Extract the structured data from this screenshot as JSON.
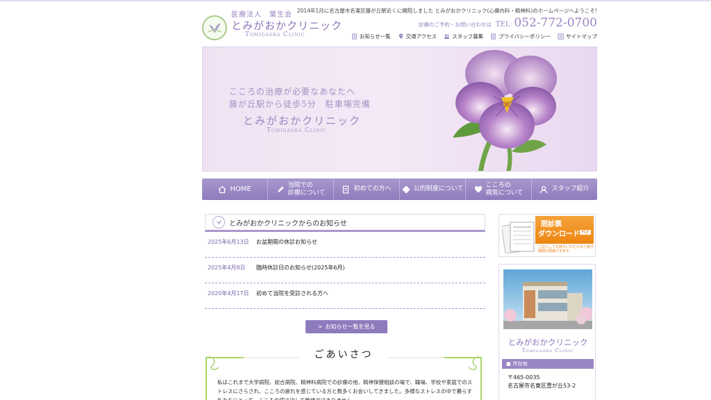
{
  "header": {
    "logo_org": "医療法人　葉生会",
    "logo_name": "とみがおかクリニック",
    "logo_en": "Tomigaoka Clinic",
    "tagline": "2014年1月に名古屋市名東区藤が丘駅近くに開院しました とみがおかクリニック(心療内科・精神科)のホームページへようこそ!",
    "contact_label": "診療のご予約・お問い合わせは",
    "tel_label": "TEL",
    "tel": "052-772-0700",
    "util_nav": [
      {
        "label": "お知らせ一覧",
        "icon": "document-icon"
      },
      {
        "label": "交通アクセス",
        "icon": "map-pin-icon"
      },
      {
        "label": "スタッフ募集",
        "icon": "people-icon"
      },
      {
        "label": "プライバシーポリシー",
        "icon": "document-icon"
      },
      {
        "label": "サイトマップ",
        "icon": "sitemap-icon"
      }
    ]
  },
  "hero": {
    "line1": "こころの治療が必要なあなたへ",
    "line2": "藤が丘駅から徒歩5分　駐車場完備",
    "name": "とみがおかクリニック",
    "name_en": "Tomigaoka Clinic"
  },
  "main_nav": [
    {
      "l1": "HOME",
      "l2": "",
      "icon": "home-icon"
    },
    {
      "l1": "当院での",
      "l2": "診療について",
      "icon": "pencil-icon"
    },
    {
      "l1": "初めての方へ",
      "l2": "",
      "icon": "document-icon"
    },
    {
      "l1": "公的制度について",
      "l2": "",
      "icon": "clover-icon"
    },
    {
      "l1": "こころの",
      "l2": "病気について",
      "icon": "heart-icon"
    },
    {
      "l1": "スタッフ紹介",
      "l2": "",
      "icon": "person-icon"
    }
  ],
  "news": {
    "title": "とみがおかクリニックからのお知らせ",
    "items": [
      {
        "date": "2025年6月13日",
        "text": "お盆期間の休診お知らせ"
      },
      {
        "date": "2025年4月8日",
        "text": "臨時休診日のお知らせ(2025年6月)"
      },
      {
        "date": "2020年4月17日",
        "text": "初めて当院を受診される方へ"
      }
    ],
    "more_label": "お知らせ一覧を見る"
  },
  "greeting": {
    "title": "ごあいさつ",
    "body": "私はこれまで大学病院、総合病院、精神科病院での診療の他、精神保健相談の場で、職場、学校や家庭でのストレスにさらされ、こころの疲れを感じている方と数多くお会いしてきました。多様なストレスの中で暮らす私たちにとって、こころの病は決して無縁ではありません。"
  },
  "sidebar": {
    "banner_l1": "問診票",
    "banner_l2": "ダウンロード",
    "banner_pdf": "PDF",
    "banner_note": "ご記入してお持ちいただけると受付時間が短縮できます。",
    "card_name": "とみがおかクリニック",
    "card_en": "Tomigaoka Clinic",
    "addr_label": "所在地",
    "zip": "〒465-0035",
    "address": "名古屋市名東区豊が丘53-2"
  },
  "colors": {
    "accent": "#8e7bbd",
    "hero_bg": "#f1e6f5",
    "banner": "#ee8612"
  }
}
